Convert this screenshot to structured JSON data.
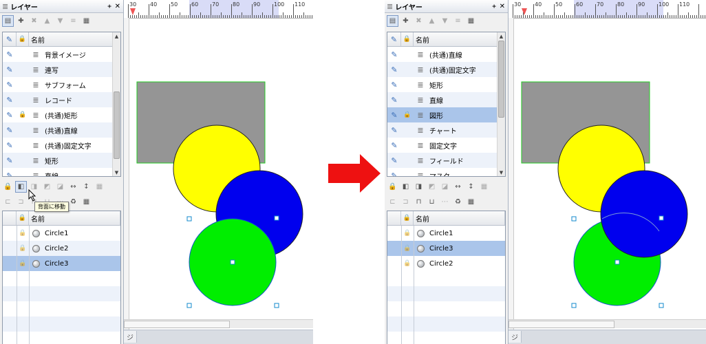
{
  "left": {
    "panel_title": "レイヤー",
    "pin_glyph": "ᚐ",
    "close_glyph": "✕",
    "layers_header": "名前",
    "layers": [
      {
        "name": "背景イメージ",
        "locked": false,
        "selected": false
      },
      {
        "name": "連写",
        "locked": false,
        "selected": false
      },
      {
        "name": "サブフォーム",
        "locked": false,
        "selected": false
      },
      {
        "name": "レコード",
        "locked": false,
        "selected": false
      },
      {
        "name": "(共通)矩形",
        "locked": true,
        "selected": false
      },
      {
        "name": "(共通)直線",
        "locked": false,
        "selected": false
      },
      {
        "name": "(共通)固定文字",
        "locked": false,
        "selected": false
      },
      {
        "name": "矩形",
        "locked": false,
        "selected": false
      },
      {
        "name": "直線",
        "locked": false,
        "selected": false
      }
    ],
    "objects_header": "名前",
    "objects": [
      {
        "name": "Circle1",
        "selected": false
      },
      {
        "name": "Circle2",
        "selected": false
      },
      {
        "name": "Circle3",
        "selected": true
      }
    ],
    "tooltip": "背面に移動",
    "bottom_tab": "ジ"
  },
  "right": {
    "panel_title": "レイヤー",
    "pin_glyph": "ᚐ",
    "close_glyph": "✕",
    "layers_header": "名前",
    "layers": [
      {
        "name": "(共通)直線",
        "locked": false,
        "selected": false
      },
      {
        "name": "(共通)固定文字",
        "locked": false,
        "selected": false
      },
      {
        "name": "矩形",
        "locked": false,
        "selected": false
      },
      {
        "name": "直線",
        "locked": false,
        "selected": false
      },
      {
        "name": "図形",
        "locked": true,
        "selected": true
      },
      {
        "name": "チャート",
        "locked": false,
        "selected": false
      },
      {
        "name": "固定文字",
        "locked": false,
        "selected": false
      },
      {
        "name": "フィールド",
        "locked": false,
        "selected": false
      },
      {
        "name": "マスク",
        "locked": false,
        "selected": false
      }
    ],
    "objects_header": "名前",
    "objects": [
      {
        "name": "Circle1",
        "selected": false
      },
      {
        "name": "Circle3",
        "selected": true
      },
      {
        "name": "Circle2",
        "selected": false
      }
    ],
    "bottom_tab": "ジ"
  },
  "ruler_labels": [
    "30",
    "40",
    "50",
    "60",
    "70",
    "80",
    "90",
    "100",
    "110"
  ],
  "colors": {
    "rect_fill": "#959595",
    "rect_border": "#22cc22",
    "circle1": "#ffff00",
    "circle2": "#0000ee",
    "circle3": "#00ee00",
    "arrow": "#ee1111",
    "selection": "#aac5ea"
  }
}
